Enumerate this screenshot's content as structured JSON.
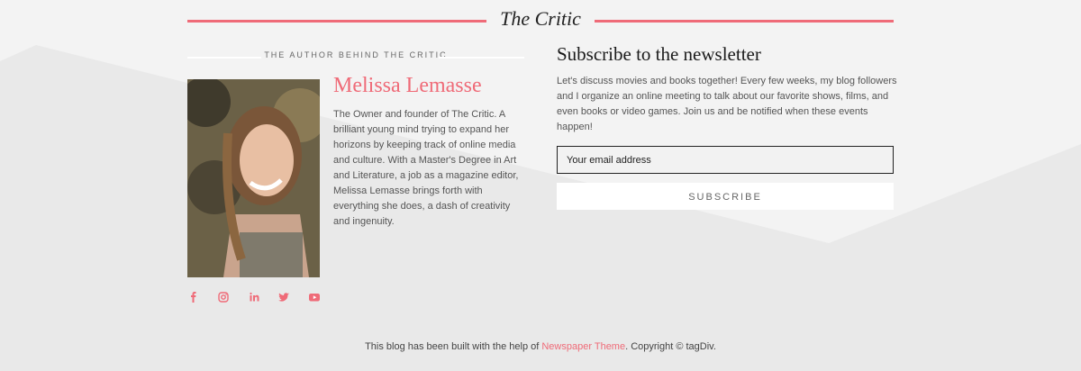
{
  "header": {
    "title": "The Critic"
  },
  "author": {
    "section_label": "THE AUTHOR BEHIND THE CRITIC",
    "name": "Melissa Lemasse",
    "bio": "The Owner and founder of The Critic. A brilliant young mind trying to expand her horizons by keeping track of online media and culture. With a Master's Degree in Art and Literature, a job as a magazine editor, Melissa Lemasse brings forth with everything she does, a dash of creativity and ingenuity."
  },
  "socials": [
    "facebook-icon",
    "instagram-icon",
    "linkedin-icon",
    "twitter-icon",
    "youtube-icon"
  ],
  "newsletter": {
    "title": "Subscribe to the newsletter",
    "description": "Let's discuss movies and books together! Every few weeks, my blog followers and I organize an online meeting to talk about our favorite shows, films, and even books or video games. Join us and be notified when these events happen!",
    "email_placeholder": "Your email address",
    "subscribe_label": "SUBSCRIBE"
  },
  "footer": {
    "text_before": "This blog has been built with the help of ",
    "link_text": "Newspaper Theme",
    "text_after": ". Copyright © tagDiv."
  },
  "colors": {
    "accent": "#ef6b78",
    "background": "#e9e9e9",
    "light_band": "#f2f2f2"
  }
}
